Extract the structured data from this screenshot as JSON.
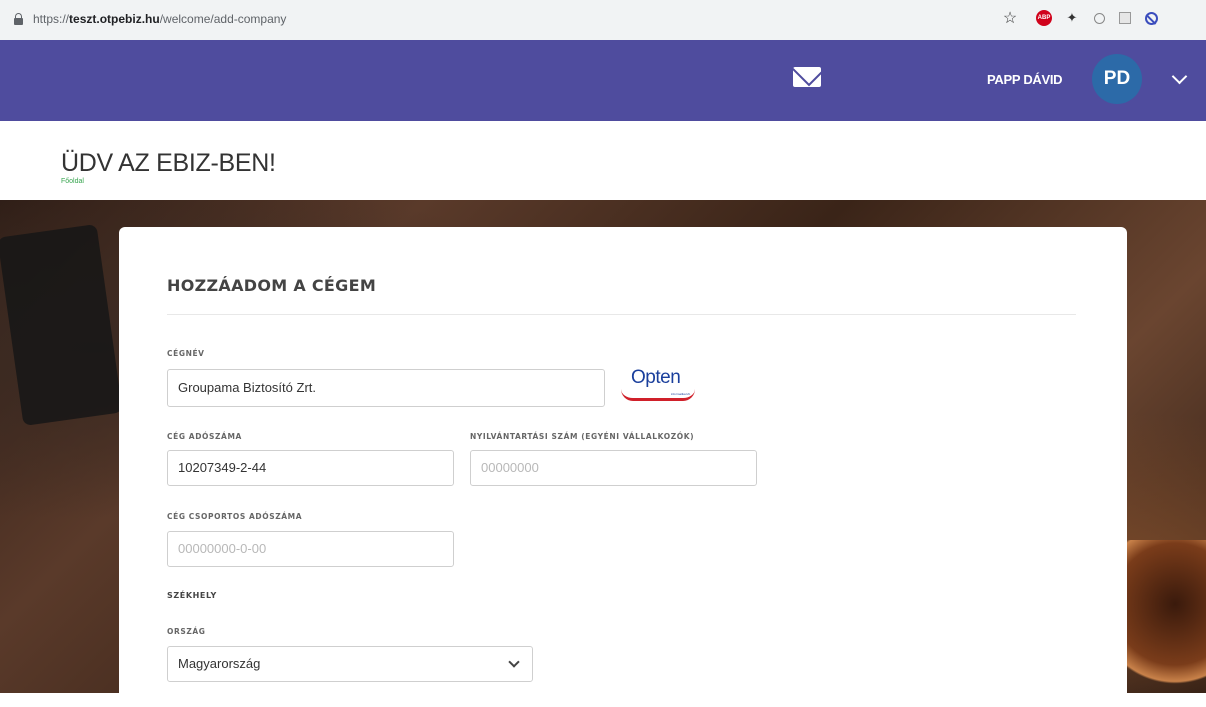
{
  "browser": {
    "url_prefix": "https://",
    "url_host": "teszt.otpebiz.hu",
    "url_path": "/welcome/add-company",
    "abp_label": "ABP",
    "bookmark_glyph": "☆"
  },
  "header": {
    "user_name": "PAPP DÁVID",
    "avatar_initials": "PD",
    "colors": {
      "bar": "#4f4c9e",
      "avatar": "#2c6aa8"
    }
  },
  "page": {
    "title": "ÜDV AZ EBIZ-BEN!",
    "breadcrumb": "Főoldal"
  },
  "form": {
    "title": "HOZZÁADOM A CÉGEM",
    "company_name": {
      "label": "CÉGNÉV",
      "value": "Groupama Biztosító Zrt."
    },
    "opten": {
      "logo_text": "Opten",
      "sub_text": "informatika kft."
    },
    "tax_number": {
      "label": "CÉG ADÓSZÁMA",
      "value": "10207349-2-44"
    },
    "registration_number": {
      "label": "NYILVÁNTARTÁSI SZÁM (EGYÉNI VÁLLALKOZÓK)",
      "placeholder": "00000000"
    },
    "group_tax_number": {
      "label": "CÉG CSOPORTOS ADÓSZÁMA",
      "placeholder": "00000000-0-00"
    },
    "seat_section": "SZÉKHELY",
    "country": {
      "label": "ORSZÁG",
      "value": "Magyarország"
    }
  }
}
